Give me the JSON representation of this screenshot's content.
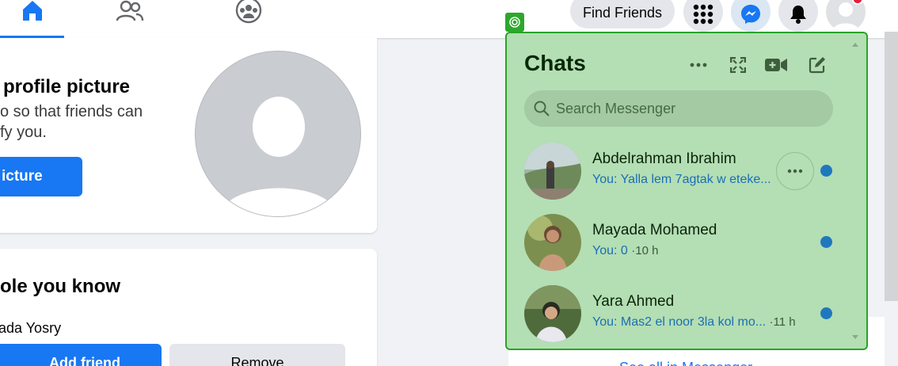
{
  "nav": {
    "find_friends": "Find Friends",
    "icons": [
      "home-icon",
      "friends-icon",
      "groups-icon",
      "menu-grid-icon",
      "messenger-icon",
      "bell-icon",
      "avatar"
    ],
    "accent": "#1877f2"
  },
  "profile_picture_card": {
    "title": "profile picture",
    "description_line1": "o so that friends can",
    "description_line2": "fy you.",
    "button": "icture"
  },
  "people_card": {
    "title": "ole you know",
    "person_name": "ada Yosry",
    "add_button": "Add friend",
    "remove_button": "Remove"
  },
  "chats": {
    "title": "Chats",
    "search_placeholder": "Search Messenger",
    "see_all": "See all in Messenger",
    "highlight_color": "#28a428",
    "items": [
      {
        "name": "Abdelrahman Ibrahim",
        "preview": "You: Yalla lem 7agtak w eteke...",
        "time": "",
        "unread": true
      },
      {
        "name": "Mayada Mohamed",
        "preview": "You: 0",
        "time": "10 h",
        "unread": true
      },
      {
        "name": "Yara Ahmed",
        "preview": "You: Mas2 el noor 3la kol mo...",
        "time": "11 h",
        "unread": true
      }
    ]
  }
}
